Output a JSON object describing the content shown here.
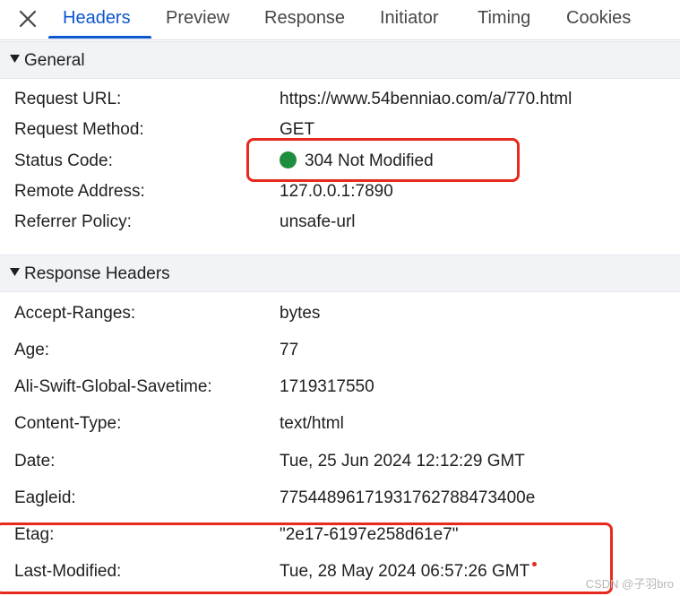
{
  "tabs": [
    {
      "label": "Headers",
      "active": true
    },
    {
      "label": "Preview",
      "active": false
    },
    {
      "label": "Response",
      "active": false
    },
    {
      "label": "Initiator",
      "active": false
    },
    {
      "label": "Timing",
      "active": false
    },
    {
      "label": "Cookies",
      "active": false
    }
  ],
  "general": {
    "title": "General",
    "rows": [
      {
        "key": "Request URL:",
        "value": "https://www.54benniao.com/a/770.html"
      },
      {
        "key": "Request Method:",
        "value": "GET"
      },
      {
        "key": "Status Code:",
        "value": "304 Not Modified"
      },
      {
        "key": "Remote Address:",
        "value": "127.0.0.1:7890"
      },
      {
        "key": "Referrer Policy:",
        "value": "unsafe-url"
      }
    ]
  },
  "response_headers": {
    "title": "Response Headers",
    "rows": [
      {
        "key": "Accept-Ranges:",
        "value": "bytes"
      },
      {
        "key": "Age:",
        "value": "77"
      },
      {
        "key": "Ali-Swift-Global-Savetime:",
        "value": "1719317550"
      },
      {
        "key": "Content-Type:",
        "value": "text/html"
      },
      {
        "key": "Date:",
        "value": "Tue, 25 Jun 2024 12:12:29 GMT"
      },
      {
        "key": "Eagleid:",
        "value": "77544896171931762788473400e"
      },
      {
        "key": "Etag:",
        "value": "\"2e17-6197e258d61e7\""
      },
      {
        "key": "Last-Modified:",
        "value": "Tue, 28 May 2024 06:57:26 GMT"
      }
    ]
  },
  "status_color": "#1e8e3e",
  "highlight_color": "#e8291d",
  "accent_color": "#0b57d0",
  "icons": {
    "close": "close-icon",
    "expand": "triangle-down-icon",
    "status": "status-dot-icon"
  },
  "watermark": "CSDN @子羽bro"
}
